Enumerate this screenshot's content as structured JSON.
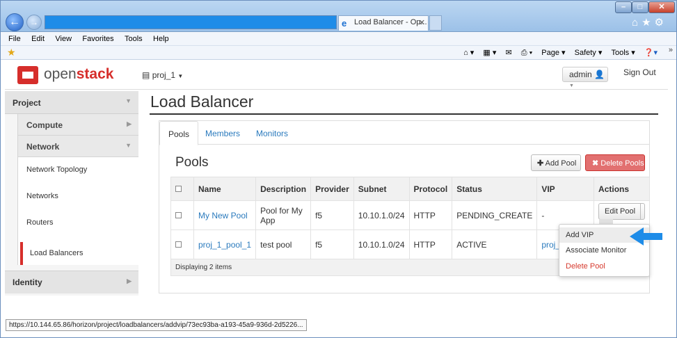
{
  "browser": {
    "tab_title": "Load Balancer - Op...",
    "tab_close": "✕",
    "menu": [
      "File",
      "Edit",
      "View",
      "Favorites",
      "Tools",
      "Help"
    ],
    "command_bar": [
      "Page ▾",
      "Safety ▾",
      "Tools ▾"
    ],
    "status_url": "https://10.144.65.86/horizon/project/loadbalancers/addvip/73ec93ba-a193-45a9-936d-2d5226..."
  },
  "header": {
    "logo_open": "open",
    "logo_stack": "stack",
    "project_selector": "proj_1",
    "user_menu": "admin",
    "sign_out": "Sign Out"
  },
  "sidebar": {
    "project": "Project",
    "compute": "Compute",
    "network": "Network",
    "links": [
      "Network Topology",
      "Networks",
      "Routers"
    ],
    "active": "Load Balancers",
    "identity": "Identity"
  },
  "main": {
    "title": "Load Balancer",
    "tabs": [
      "Pools",
      "Members",
      "Monitors"
    ],
    "section_title": "Pools",
    "add_pool": "Add Pool",
    "delete_pools": "Delete Pools",
    "columns": [
      "Name",
      "Description",
      "Provider",
      "Subnet",
      "Protocol",
      "Status",
      "VIP",
      "Actions"
    ],
    "rows": [
      {
        "name": "My New Pool",
        "description": "Pool for My App",
        "provider": "f5",
        "subnet": "10.10.1.0/24",
        "protocol": "HTTP",
        "status": "PENDING_CREATE",
        "vip": "-",
        "action": "Edit Pool"
      },
      {
        "name": "proj_1_pool_1",
        "description": "test pool",
        "provider": "f5",
        "subnet": "10.10.1.0/24",
        "protocol": "HTTP",
        "status": "ACTIVE",
        "vip": "proj_1_vip_1",
        "action": ""
      }
    ],
    "footer": "Displaying 2 items",
    "dropdown": [
      "Add VIP",
      "Associate Monitor",
      "Delete Pool"
    ]
  },
  "colors": {
    "brand_red": "#d62e2b",
    "link_blue": "#2a7abd",
    "danger": "#e27070",
    "arrow_blue": "#1e8ce8"
  }
}
